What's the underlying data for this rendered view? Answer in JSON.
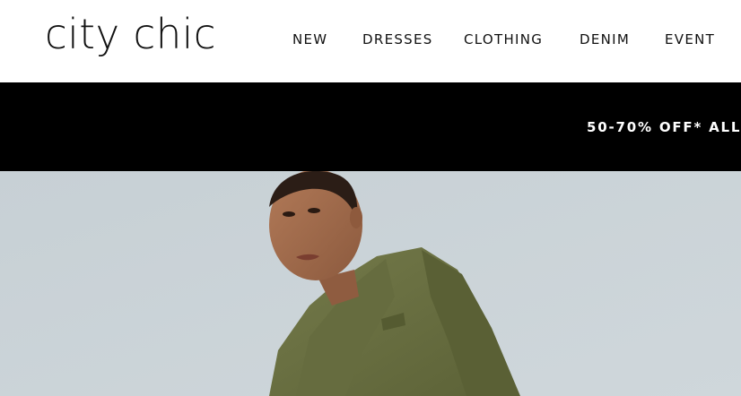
{
  "brand": {
    "logo_text": "city chic"
  },
  "nav": {
    "items": [
      {
        "label": "NEW"
      },
      {
        "label": "DRESSES"
      },
      {
        "label": "CLOTHING"
      },
      {
        "label": "DENIM"
      },
      {
        "label": "EVENT"
      }
    ]
  },
  "promo": {
    "text": "50-70% OFF* ALL"
  },
  "hero": {
    "image_subject": "model in olive green blazer against pale grey sky",
    "colors": {
      "background": "#c9d2d7",
      "blazer": "#6b7142",
      "skin": "#a06a4c",
      "hair": "#2b1d16"
    }
  }
}
